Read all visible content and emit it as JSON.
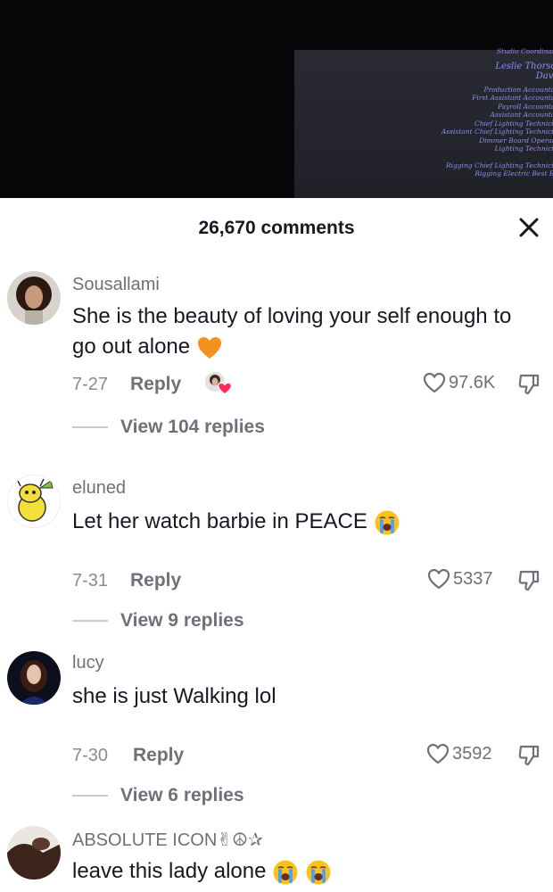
{
  "video": {
    "credits": [
      "Studio Coordinator",
      "Leslie Thorson",
      "David",
      "Production Accountant",
      "First Assistant Accountant",
      "Payroll Accountant",
      "Assistant Accountant",
      "Chief Lighting Technician",
      "Assistant Chief Lighting Technician",
      "Dimmer Board Operator",
      "Lighting Technician",
      "Rigging Chief Lighting Technician",
      "Rigging Electric Best Boy"
    ]
  },
  "header": {
    "title": "26,670 comments"
  },
  "comments": [
    {
      "username": "Sousallami",
      "text": "She is the beauty of loving your self enough to go out alone",
      "emoji": "orange-heart",
      "date": "7-27",
      "reply_label": "Reply",
      "likes": "97.6K",
      "view_replies": "View 104 replies",
      "creator_liked": true
    },
    {
      "username": "eluned",
      "text": "Let her watch barbie in PEACE",
      "emoji": "loudly-crying-face",
      "date": "7-31",
      "reply_label": "Reply",
      "likes": "5337",
      "view_replies": "View 9 replies"
    },
    {
      "username": "lucy",
      "text": "she is just Walking lol",
      "date": "7-30",
      "reply_label": "Reply",
      "likes": "3592",
      "view_replies": "View 6 replies"
    },
    {
      "username": "ABSOLUTE ICON✌☮✰",
      "text": "leave this lady alone",
      "emoji": "loudly-crying-face x2"
    }
  ],
  "colors": {
    "text_primary": "#161823",
    "text_secondary": "#6f7079",
    "credit_text": "#8d8ff0",
    "like_heart_badge": "#fe2c55"
  }
}
